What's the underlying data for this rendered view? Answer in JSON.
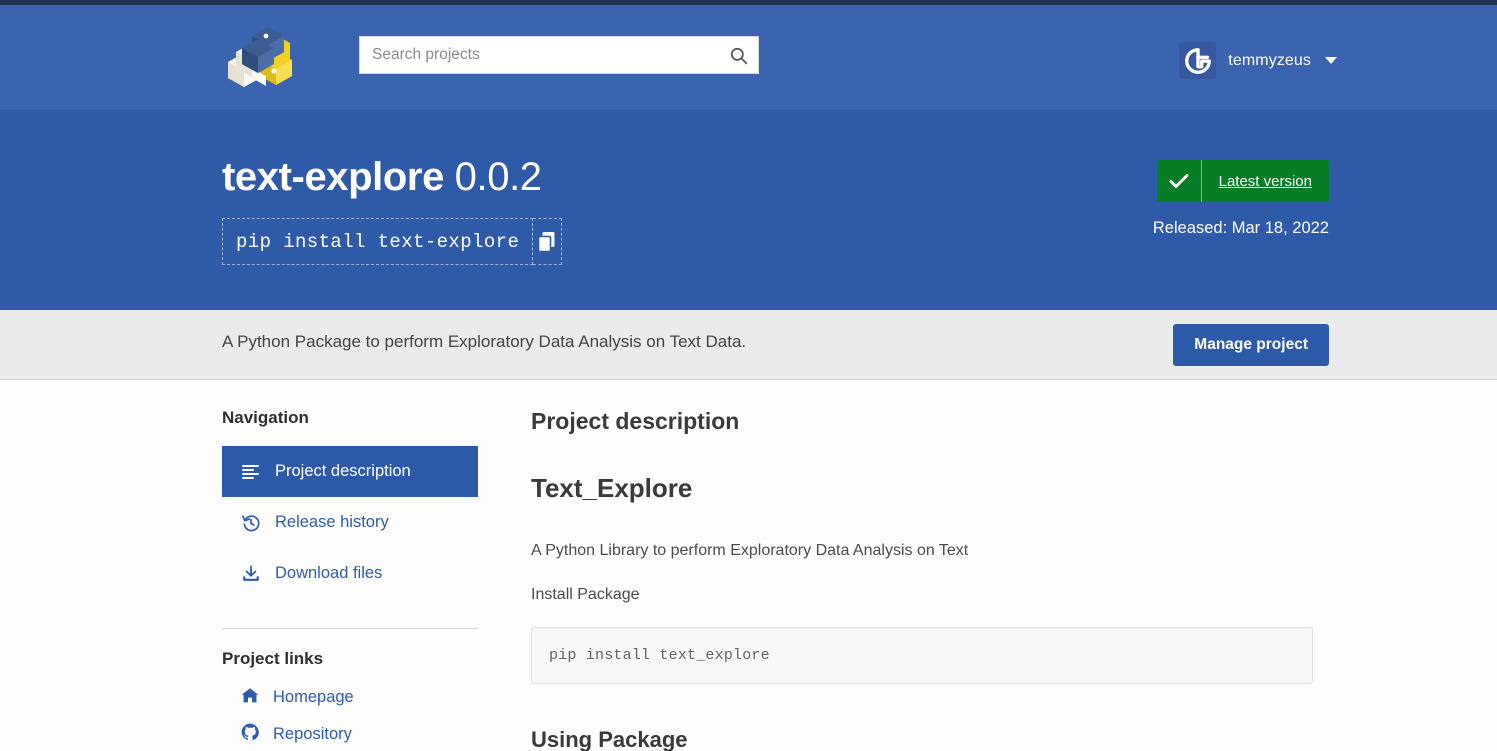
{
  "header": {
    "logo_icon": "pypi-cubes-logo",
    "search": {
      "placeholder": "Search projects",
      "value": "",
      "icon": "search-icon"
    },
    "user": {
      "name": "temmyzeus",
      "avatar_icon": "gravatar-avatar-icon",
      "caret_icon": "chevron-down-icon"
    }
  },
  "hero": {
    "package_name": "text-explore",
    "version": "0.0.2",
    "pip_command": "pip install text-explore",
    "copy_icon": "copy-icon",
    "badge": {
      "check_icon": "check-icon",
      "label": "Latest version",
      "color": "#067e26"
    },
    "released": "Released: Mar 18, 2022"
  },
  "description_band": {
    "summary": "A Python Package to perform Exploratory Data Analysis on Text Data.",
    "manage_button": "Manage project"
  },
  "sidebar": {
    "navigation_title": "Navigation",
    "nav_items": [
      {
        "label": "Project description",
        "icon": "align-left-icon",
        "active": true
      },
      {
        "label": "Release history",
        "icon": "history-icon",
        "active": false
      },
      {
        "label": "Download files",
        "icon": "download-icon",
        "active": false
      }
    ],
    "links_title": "Project links",
    "links": [
      {
        "label": "Homepage",
        "icon": "home-icon"
      },
      {
        "label": "Repository",
        "icon": "github-icon"
      }
    ]
  },
  "main": {
    "section_title": "Project description",
    "doc_title": "Text_Explore",
    "paragraph_1": "A Python Library to perform Exploratory Data Analysis on Text",
    "paragraph_2": "Install Package",
    "code_block": "pip install text_explore",
    "doc_subtitle": "Using Package"
  },
  "colors": {
    "header_blue": "#3b63b0",
    "hero_blue": "#2e5aa8",
    "accent_blue": "#2d5aa8",
    "link_blue": "#2f5caa",
    "band_gray": "#ebebeb",
    "badge_green": "#067e26"
  }
}
